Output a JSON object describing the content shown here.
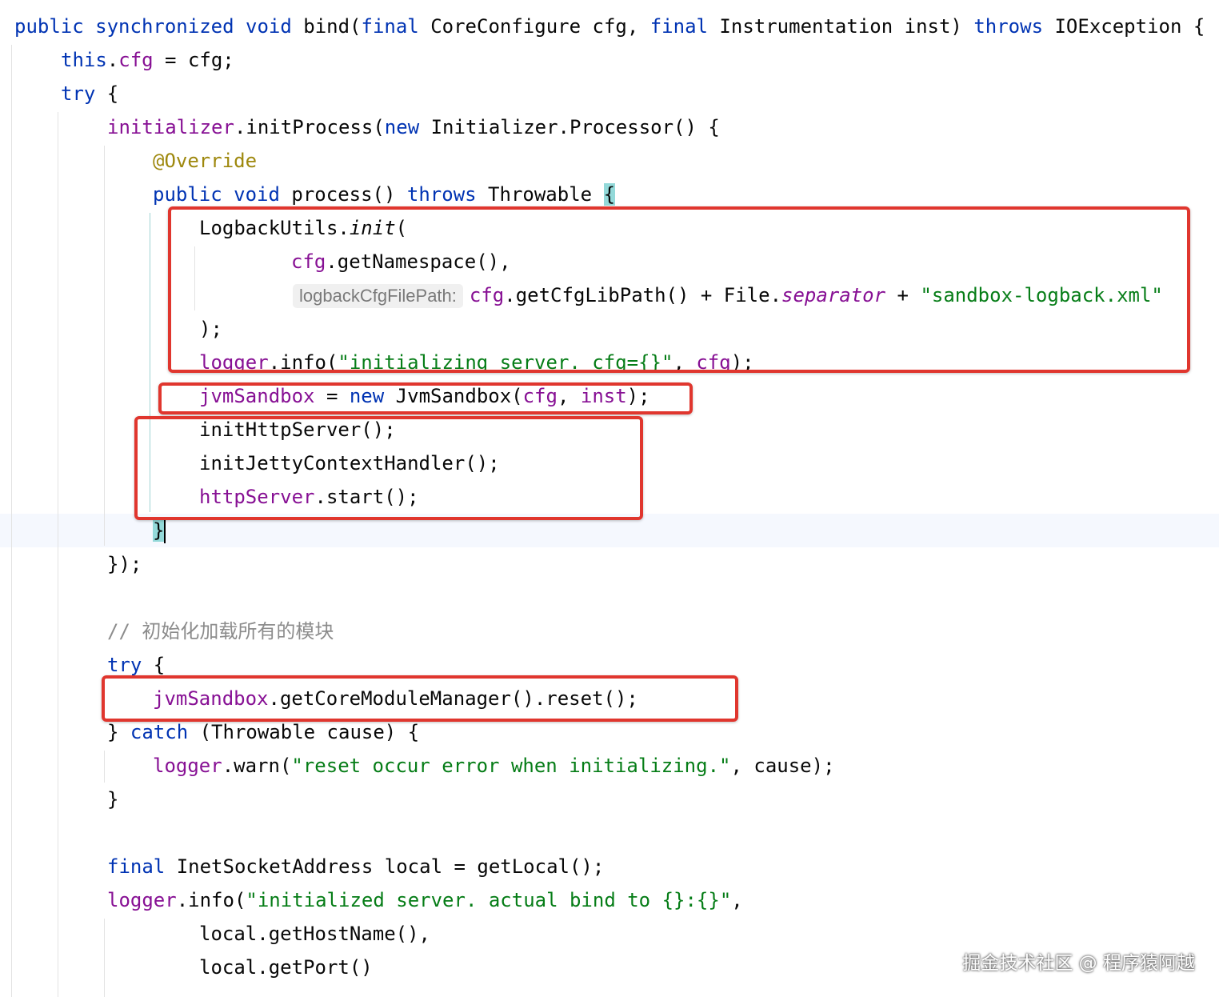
{
  "code": {
    "l01": {
      "a": "public",
      "b": " ",
      "c": "synchronized",
      "d": " ",
      "e": "void",
      "f": " bind(",
      "g": "final",
      "h": " CoreConfigure cfg, ",
      "i": "final",
      "j": " Instrumentation inst) ",
      "k": "throws",
      "l": " IOException {"
    },
    "l02": {
      "a": "this",
      ".": ".",
      "b": "cfg",
      "c": " = cfg;"
    },
    "l03": {
      "a": "try",
      "b": " {"
    },
    "l04": {
      "a": "initializer",
      "b": ".initProcess(",
      "c": "new",
      "d": " Initializer.Processor() {"
    },
    "l05": {
      "a": "@Override"
    },
    "l06": {
      "a": "public",
      "b": " ",
      "c": "void",
      "d": " process() ",
      "e": "throws",
      "f": " Throwable ",
      "g": "{"
    },
    "l07": {
      "a": "LogbackUtils.",
      "b": "init",
      "c": "("
    },
    "l08": {
      "a": "cfg",
      "b": ".getNamespace(),"
    },
    "l09": {
      "hint": "logbackCfgFilePath:",
      "a": "cfg",
      "b": ".getCfgLibPath() + File.",
      "c": "separator",
      "d": " + ",
      "e": "\"sandbox-logback.xml\""
    },
    "l10": {
      "a": ");"
    },
    "l11": {
      "a": "logger",
      "b": ".info(",
      "c": "\"initializing server. cfg={}\"",
      "d": ", ",
      "e": "cfg",
      "f": ");"
    },
    "l12": {
      "a": "jvmSandbox",
      "b": " = ",
      "c": "new",
      "d": " JvmSandbox(",
      "e": "cfg",
      "f": ", ",
      "g": "inst",
      "h": ");"
    },
    "l13": {
      "a": "initHttpServer();"
    },
    "l14": {
      "a": "initJettyContextHandler();"
    },
    "l15": {
      "a": "httpServer",
      "b": ".start();"
    },
    "l16": {
      "a": "}"
    },
    "l17": {
      "a": "});"
    },
    "l18": {
      "a": "// 初始化加载所有的模块"
    },
    "l19": {
      "a": "try",
      "b": " {"
    },
    "l20": {
      "a": "jvmSandbox",
      "b": ".getCoreModuleManager().reset();"
    },
    "l21": {
      "a": "} ",
      "b": "catch",
      "c": " (Throwable cause) {"
    },
    "l22": {
      "a": "logger",
      "b": ".warn(",
      "c": "\"reset occur error when initializing.\"",
      "d": ", cause);"
    },
    "l23": {
      "a": "}"
    },
    "l24": {
      "a": "final",
      "b": " InetSocketAddress local = getLocal();"
    },
    "l25": {
      "a": "logger",
      "b": ".info(",
      "c": "\"initialized server. actual bind to {}:{}\"",
      "d": ","
    },
    "l26": {
      "a": "local.getHostName(),"
    },
    "l27": {
      "a": "local.getPort()"
    }
  },
  "watermark": "掘金技术社区 @ 程序猿阿越"
}
